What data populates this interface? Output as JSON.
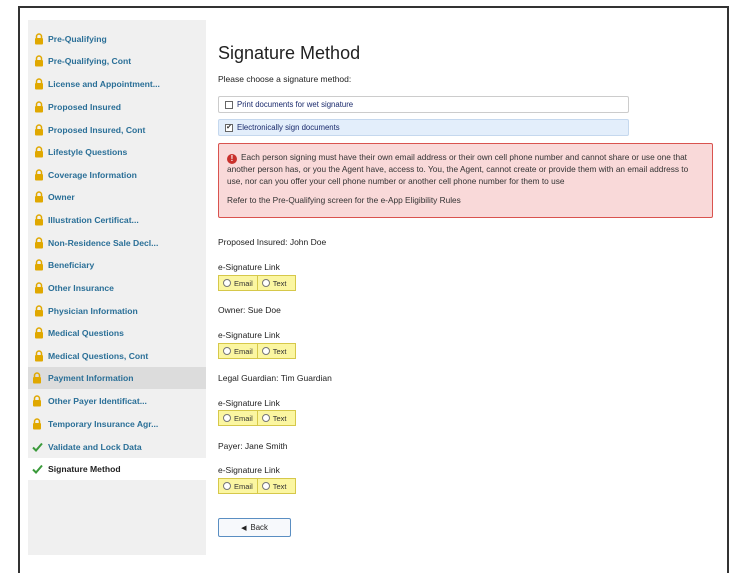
{
  "sidebar": {
    "items": [
      {
        "label": "Pre-Qualifying",
        "icon": "lock-icon",
        "state": "locked"
      },
      {
        "label": "Pre-Qualifying, Cont",
        "icon": "lock-icon",
        "state": "locked"
      },
      {
        "label": "License and Appointment...",
        "icon": "lock-icon",
        "state": "locked"
      },
      {
        "label": "Proposed Insured",
        "icon": "lock-icon",
        "state": "locked"
      },
      {
        "label": "Proposed Insured, Cont",
        "icon": "lock-icon",
        "state": "locked"
      },
      {
        "label": "Lifestyle Questions",
        "icon": "lock-icon",
        "state": "locked"
      },
      {
        "label": "Coverage Information",
        "icon": "lock-icon",
        "state": "locked"
      },
      {
        "label": "Owner",
        "icon": "lock-icon",
        "state": "locked"
      },
      {
        "label": "Illustration Certificat...",
        "icon": "lock-icon",
        "state": "locked"
      },
      {
        "label": "Non-Residence Sale Decl...",
        "icon": "lock-icon",
        "state": "locked"
      },
      {
        "label": "Beneficiary",
        "icon": "lock-icon",
        "state": "locked"
      },
      {
        "label": "Other Insurance",
        "icon": "lock-icon",
        "state": "locked"
      },
      {
        "label": "Physician Information",
        "icon": "lock-icon",
        "state": "locked"
      },
      {
        "label": "Medical Questions",
        "icon": "lock-icon",
        "state": "locked"
      },
      {
        "label": "Medical Questions, Cont",
        "icon": "lock-icon",
        "state": "locked"
      },
      {
        "label": "Payment Information",
        "icon": "lock-icon",
        "state": "locked"
      },
      {
        "label": "Other Payer Identificat...",
        "icon": "lock-icon",
        "state": "locked"
      },
      {
        "label": "Temporary Insurance Agr...",
        "icon": "lock-icon",
        "state": "locked"
      },
      {
        "label": "Validate and Lock Data",
        "icon": "check-icon",
        "state": "done"
      },
      {
        "label": "Signature Method",
        "icon": "check-icon",
        "state": "active"
      }
    ]
  },
  "main": {
    "title": "Signature Method",
    "prompt": "Please choose a signature method:",
    "options": [
      {
        "label": "Print documents for wet signature",
        "checked": false
      },
      {
        "label": "Electronically sign documents",
        "checked": true
      }
    ],
    "alert": {
      "text1": "Each person signing must have their own email address or their own cell phone number and cannot share or use one that another person has, or you the Agent have, access to. You, the Agent, cannot create or provide them with an email address to use, nor can you offer your cell phone number or another cell phone number for them to use",
      "text2": "Refer to the Pre-Qualifying screen for the e-App Eligibility Rules"
    },
    "signers": [
      {
        "person": "Proposed Insured: John Doe",
        "link_label": "e-Signature Link",
        "email": "Email",
        "text": "Text"
      },
      {
        "person": "Owner: Sue Doe",
        "link_label": "e-Signature Link",
        "email": "Email",
        "text": "Text"
      },
      {
        "person": "Legal Guardian: Tim Guardian",
        "link_label": "e-Signature Link",
        "email": "Email",
        "text": "Text"
      },
      {
        "person": "Payer: Jane Smith",
        "link_label": "e-Signature Link",
        "email": "Email",
        "text": "Text"
      }
    ],
    "back_label": "Back"
  },
  "colors": {
    "nav_link": "#2a6f97",
    "lock": "#e0a800",
    "check": "#3a9a3a",
    "alert_bg": "#f9d9d9",
    "alert_border": "#d9534f",
    "radio_bg": "#fbf6a1"
  }
}
